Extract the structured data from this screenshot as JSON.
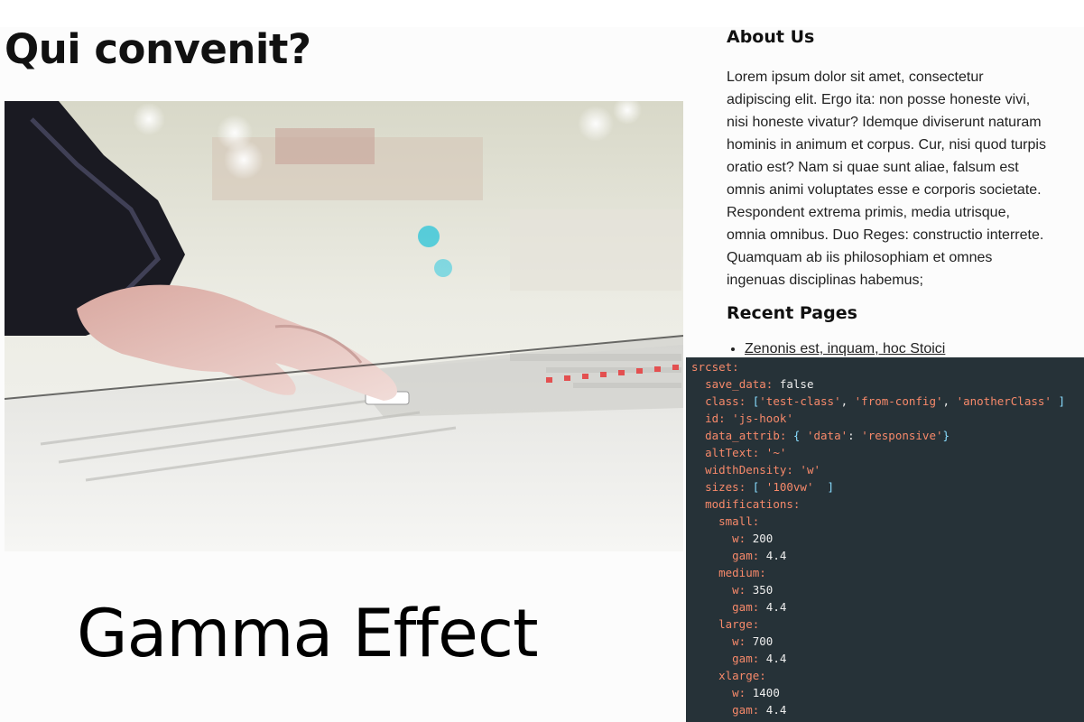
{
  "post": {
    "title": "Qui convenit?",
    "image_alt": "Hand adjusting faders on an audio mixing console",
    "caption": "Gamma Effect"
  },
  "sidebar": {
    "about": {
      "title": "About Us",
      "text": "Lorem ipsum dolor sit amet, consectetur adipiscing elit. Ergo ita: non posse honeste vivi, nisi honeste vivatur? Idemque diviserunt naturam hominis in animum et corpus. Cur, nisi quod turpis oratio est? Nam si quae sunt aliae, falsum est omnis animi voluptates esse e corporis societate. Respondent extrema primis, media utrisque, omnia omnibus. Duo Reges: constructio interrete. Quamquam ab iis philosophiam et omnes ingenuas disciplinas habemus;"
    },
    "recent": {
      "title": "Recent Pages",
      "items": [
        "Zenonis est, inquam, hoc Stoici"
      ]
    }
  },
  "code": {
    "lines": [
      {
        "indent": 0,
        "key": "srcset:",
        "rest": []
      },
      {
        "indent": 1,
        "key": "save_data:",
        "rest": [
          {
            "t": "v",
            "x": " false"
          }
        ]
      },
      {
        "indent": 1,
        "key": "class:",
        "rest": [
          {
            "t": "p",
            "x": " ["
          },
          {
            "t": "s",
            "x": "'test-class'"
          },
          {
            "t": "v",
            "x": ", "
          },
          {
            "t": "s",
            "x": "'from-config'"
          },
          {
            "t": "v",
            "x": ", "
          },
          {
            "t": "s",
            "x": "'anotherClass'"
          },
          {
            "t": "p",
            "x": " ]"
          }
        ]
      },
      {
        "indent": 1,
        "key": "id:",
        "rest": [
          {
            "t": "s",
            "x": " 'js-hook'"
          }
        ]
      },
      {
        "indent": 1,
        "key": "data_attrib:",
        "rest": [
          {
            "t": "p",
            "x": " {"
          },
          {
            "t": "s",
            "x": " 'data'"
          },
          {
            "t": "v",
            "x": ": "
          },
          {
            "t": "s",
            "x": "'responsive'"
          },
          {
            "t": "p",
            "x": "}"
          }
        ]
      },
      {
        "indent": 1,
        "key": "altText:",
        "rest": [
          {
            "t": "s",
            "x": " '~'"
          }
        ]
      },
      {
        "indent": 1,
        "key": "widthDensity:",
        "rest": [
          {
            "t": "s",
            "x": " 'w'"
          }
        ]
      },
      {
        "indent": 1,
        "key": "sizes:",
        "rest": [
          {
            "t": "p",
            "x": " ["
          },
          {
            "t": "s",
            "x": " '100vw'"
          },
          {
            "t": "p",
            "x": "  ]"
          }
        ]
      },
      {
        "indent": 1,
        "key": "modifications:",
        "rest": []
      },
      {
        "indent": 2,
        "key": "small:",
        "rest": []
      },
      {
        "indent": 3,
        "key": "w:",
        "rest": [
          {
            "t": "v",
            "x": " 200"
          }
        ]
      },
      {
        "indent": 3,
        "key": "gam:",
        "rest": [
          {
            "t": "v",
            "x": " 4.4"
          }
        ]
      },
      {
        "indent": 2,
        "key": "medium:",
        "rest": []
      },
      {
        "indent": 3,
        "key": "w:",
        "rest": [
          {
            "t": "v",
            "x": " 350"
          }
        ]
      },
      {
        "indent": 3,
        "key": "gam:",
        "rest": [
          {
            "t": "v",
            "x": " 4.4"
          }
        ]
      },
      {
        "indent": 2,
        "key": "large:",
        "rest": []
      },
      {
        "indent": 3,
        "key": "w:",
        "rest": [
          {
            "t": "v",
            "x": " 700"
          }
        ]
      },
      {
        "indent": 3,
        "key": "gam:",
        "rest": [
          {
            "t": "v",
            "x": " 4.4"
          }
        ]
      },
      {
        "indent": 2,
        "key": "xlarge:",
        "rest": []
      },
      {
        "indent": 3,
        "key": "w:",
        "rest": [
          {
            "t": "v",
            "x": " 1400"
          }
        ]
      },
      {
        "indent": 3,
        "key": "gam:",
        "rest": [
          {
            "t": "v",
            "x": " 4.4"
          }
        ]
      }
    ]
  },
  "colors": {
    "code_bg": "#263238",
    "code_key": "#f7896a",
    "code_punct": "#89ddff",
    "code_value": "#eeeeee"
  }
}
